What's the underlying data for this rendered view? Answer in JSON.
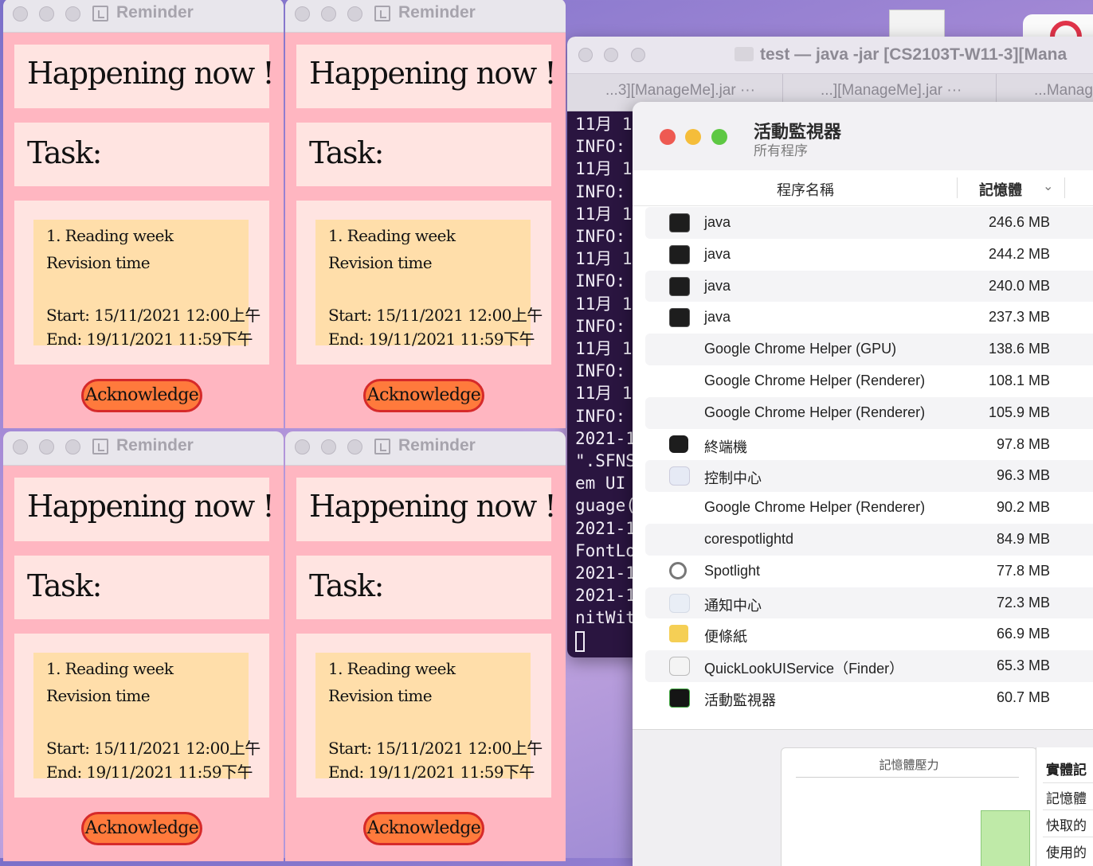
{
  "terminal": {
    "title": "test — java -jar [CS2103T-W11-3][Mana",
    "tabs": [
      "...3][ManageMe].jar   ···",
      "...][ManageMe].jar   ···",
      "...Manag"
    ],
    "lines": [
      "11月 1",
      "INFO:",
      "11月 1",
      "INFO:",
      "11月 1",
      "INFO:",
      "11月 1",
      "INFO:",
      "11月 1",
      "INFO:",
      "11月 1",
      "INFO:",
      "11月 1",
      "INFO:",
      "2021-1",
      "\".SFNS",
      "em UI",
      "guage(",
      "2021-1",
      "FontLo",
      "2021-1",
      "2021-1",
      "nitWit"
    ]
  },
  "activity_monitor": {
    "title": "活動監視器",
    "subtitle": "所有程序",
    "column_name": "程序名稱",
    "column_memory": "記憶體",
    "processes": [
      {
        "name": "java",
        "memory": "246.6 MB",
        "icon": "terminal-app-icon"
      },
      {
        "name": "java",
        "memory": "244.2 MB",
        "icon": "terminal-app-icon"
      },
      {
        "name": "java",
        "memory": "240.0 MB",
        "icon": "terminal-app-icon"
      },
      {
        "name": "java",
        "memory": "237.3 MB",
        "icon": "terminal-app-icon"
      },
      {
        "name": "Google Chrome Helper (GPU)",
        "memory": "138.6 MB",
        "icon": ""
      },
      {
        "name": "Google Chrome Helper (Renderer)",
        "memory": "108.1 MB",
        "icon": ""
      },
      {
        "name": "Google Chrome Helper (Renderer)",
        "memory": "105.9 MB",
        "icon": ""
      },
      {
        "name": "終端機",
        "memory": "97.8 MB",
        "icon": "terminal-icon"
      },
      {
        "name": "控制中心",
        "memory": "96.3 MB",
        "icon": "control-center-icon"
      },
      {
        "name": "Google Chrome Helper (Renderer)",
        "memory": "90.2 MB",
        "icon": ""
      },
      {
        "name": "corespotlightd",
        "memory": "84.9 MB",
        "icon": ""
      },
      {
        "name": "Spotlight",
        "memory": "77.8 MB",
        "icon": "magnifier-icon"
      },
      {
        "name": "通知中心",
        "memory": "72.3 MB",
        "icon": "notification-center-icon"
      },
      {
        "name": "便條紙",
        "memory": "66.9 MB",
        "icon": "stickies-icon"
      },
      {
        "name": "QuickLookUIService（Finder）",
        "memory": "65.3 MB",
        "icon": "shield-icon"
      },
      {
        "name": "活動監視器",
        "memory": "60.7 MB",
        "icon": "activity-monitor-icon"
      }
    ],
    "footer": {
      "pressure_title": "記憶體壓力",
      "side_items": [
        "實體記",
        "記憶體",
        "快取的",
        "使用的"
      ]
    }
  },
  "reminder": {
    "window_title": "Reminder",
    "heading": "Happening now !",
    "task_label": "Task:",
    "item_line1": "1.  Reading week",
    "item_line2": "Revision time",
    "item_start": "Start: 15/11/2021 12:00上午",
    "item_end": "End: 19/11/2021 11:59下午",
    "ack_label": "Acknowledge"
  },
  "colors": {
    "reminder_bg": "#ffb6c1",
    "reminder_box": "#ffe4e1",
    "reminder_card": "#ffdeaa",
    "ack_fill": "#ff7a3c",
    "ack_border": "#d62a2a"
  }
}
